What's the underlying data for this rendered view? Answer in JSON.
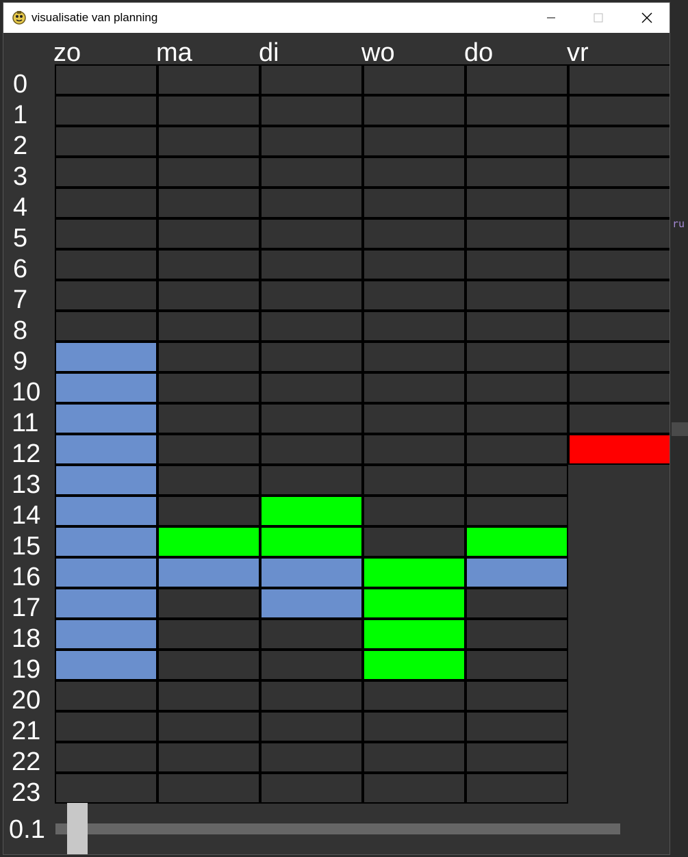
{
  "window": {
    "title": "visualisatie van planning"
  },
  "background": {
    "peek_text": "ru"
  },
  "colors": {
    "empty": "#333333",
    "blue": "#6a8fcd",
    "green": "#00ff00",
    "red": "#ff0000",
    "grid_line": "#000000"
  },
  "days": [
    "zo",
    "ma",
    "di",
    "wo",
    "do",
    "vr"
  ],
  "hours": [
    "0",
    "1",
    "2",
    "3",
    "4",
    "5",
    "6",
    "7",
    "8",
    "9",
    "10",
    "11",
    "12",
    "13",
    "14",
    "15",
    "16",
    "17",
    "18",
    "19",
    "20",
    "21",
    "22",
    "23"
  ],
  "rows_per_day": [
    24,
    24,
    24,
    24,
    24,
    13
  ],
  "filled_cells": [
    {
      "day": 0,
      "hour": 9,
      "color": "blue"
    },
    {
      "day": 0,
      "hour": 10,
      "color": "blue"
    },
    {
      "day": 0,
      "hour": 11,
      "color": "blue"
    },
    {
      "day": 0,
      "hour": 12,
      "color": "blue"
    },
    {
      "day": 0,
      "hour": 13,
      "color": "blue"
    },
    {
      "day": 0,
      "hour": 14,
      "color": "blue"
    },
    {
      "day": 0,
      "hour": 15,
      "color": "blue"
    },
    {
      "day": 0,
      "hour": 16,
      "color": "blue"
    },
    {
      "day": 0,
      "hour": 17,
      "color": "blue"
    },
    {
      "day": 0,
      "hour": 18,
      "color": "blue"
    },
    {
      "day": 0,
      "hour": 19,
      "color": "blue"
    },
    {
      "day": 1,
      "hour": 15,
      "color": "green"
    },
    {
      "day": 1,
      "hour": 16,
      "color": "blue"
    },
    {
      "day": 2,
      "hour": 14,
      "color": "green"
    },
    {
      "day": 2,
      "hour": 15,
      "color": "green"
    },
    {
      "day": 2,
      "hour": 16,
      "color": "blue"
    },
    {
      "day": 2,
      "hour": 17,
      "color": "blue"
    },
    {
      "day": 3,
      "hour": 16,
      "color": "green"
    },
    {
      "day": 3,
      "hour": 17,
      "color": "green"
    },
    {
      "day": 3,
      "hour": 18,
      "color": "green"
    },
    {
      "day": 3,
      "hour": 19,
      "color": "green"
    },
    {
      "day": 4,
      "hour": 15,
      "color": "green"
    },
    {
      "day": 4,
      "hour": 16,
      "color": "blue"
    },
    {
      "day": 5,
      "hour": 12,
      "color": "red"
    }
  ],
  "slider": {
    "value_label": "0.1",
    "position_fraction": 0.03
  }
}
